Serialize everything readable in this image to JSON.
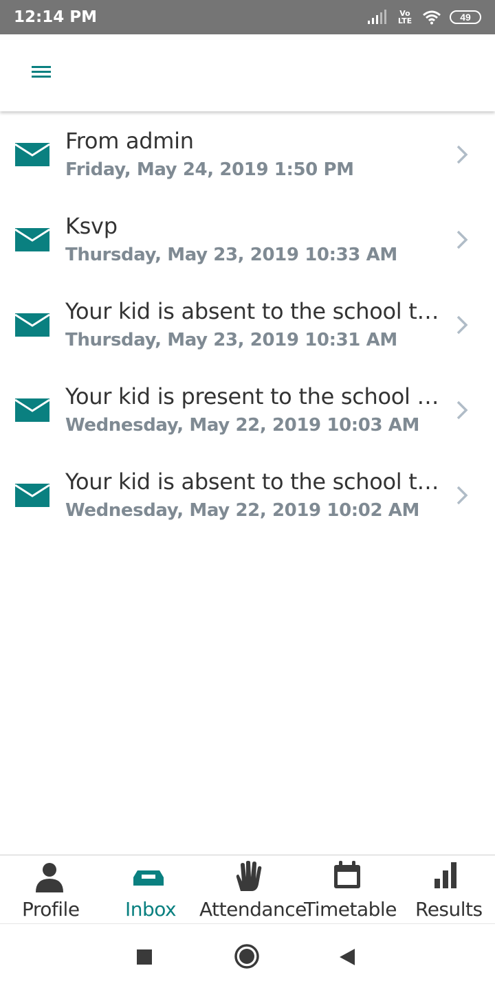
{
  "status_bar": {
    "time": "12:14 PM",
    "network_label": "Vo LTE",
    "battery": "49",
    "icons": [
      "signal-icon",
      "volte-icon",
      "wifi-icon",
      "battery-icon"
    ]
  },
  "app_bar": {
    "menu_icon": "hamburger-menu-icon"
  },
  "colors": {
    "accent": "#0a8080",
    "text": "#333333",
    "date": "#7f8a93",
    "chevron": "#b0bcc7",
    "icon_dark": "#3a3a3a"
  },
  "messages": [
    {
      "title": "From admin",
      "date": "Friday, May 24, 2019 1:50 PM"
    },
    {
      "title": "Ksvp",
      "date": "Thursday, May 23, 2019 10:33 AM"
    },
    {
      "title": "Your kid is absent to the school today",
      "date": "Thursday, May 23, 2019 10:31 AM"
    },
    {
      "title": "Your kid is present to the school today",
      "date": "Wednesday, May 22, 2019 10:03 AM"
    },
    {
      "title": "Your kid is absent to the school today",
      "date": "Wednesday, May 22, 2019 10:02 AM"
    }
  ],
  "bottom_nav": {
    "tabs": [
      {
        "label": "Profile",
        "icon": "person-icon",
        "active": false
      },
      {
        "label": "Inbox",
        "icon": "inbox-icon",
        "active": true
      },
      {
        "label": "Attendance",
        "icon": "hand-icon",
        "active": false
      },
      {
        "label": "Timetable",
        "icon": "calendar-icon",
        "active": false
      },
      {
        "label": "Results",
        "icon": "bar-chart-icon",
        "active": false
      }
    ]
  },
  "system_nav": {
    "buttons": [
      "recents-button",
      "home-button",
      "back-button"
    ]
  }
}
